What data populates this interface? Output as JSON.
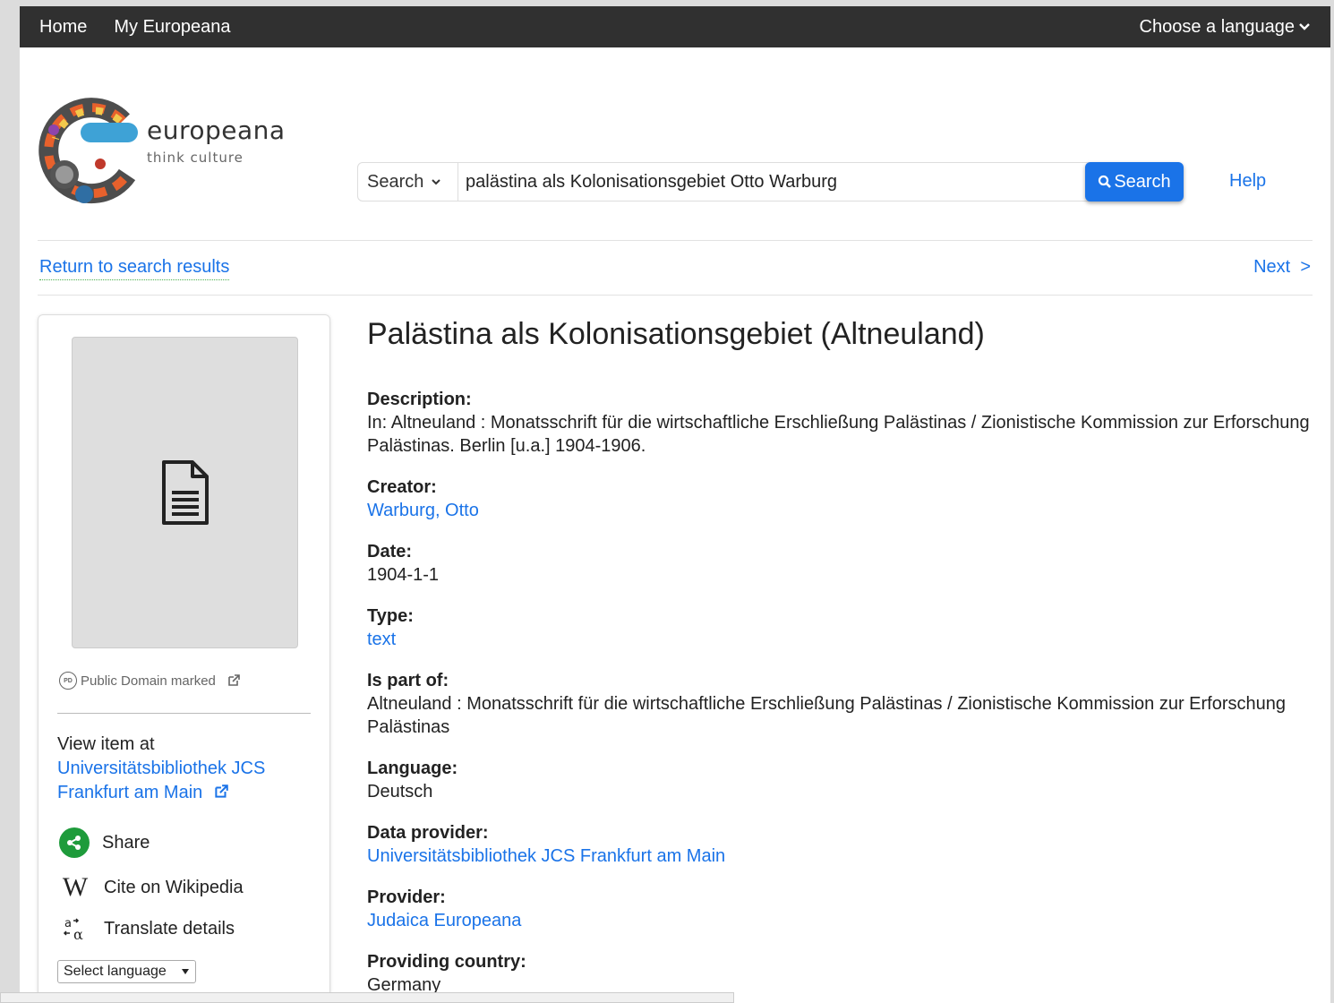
{
  "topbar": {
    "nav": [
      "Home",
      "My Europeana"
    ],
    "language_label": "Choose a language"
  },
  "logo": {
    "word": "europeana",
    "tagline": "think culture"
  },
  "search": {
    "type_label": "Search",
    "query": "palästina als Kolonisationsgebiet Otto Warburg",
    "button_label": "Search"
  },
  "help_label": "Help",
  "navigation": {
    "return_label": "Return to search results",
    "next_label": "Next  >"
  },
  "sidebar": {
    "rights_label": "Public Domain marked",
    "rights_badge": "PD",
    "view_item_at": "View item at",
    "provider_name": "Universitätsbibliothek JCS Frankfurt am Main",
    "actions": {
      "share": "Share",
      "cite": "Cite on Wikipedia",
      "translate": "Translate details"
    },
    "select_language": "Select language"
  },
  "item": {
    "title": "Palästina als Kolonisationsgebiet (Altneuland)",
    "fields": [
      {
        "label": "Description:",
        "value": "In: Altneuland : Monatsschrift für die wirtschaftliche Erschließung Palästinas / Zionistische Kommission zur Erforschung Palästinas. Berlin [u.a.] 1904-1906.",
        "link": false
      },
      {
        "label": "Creator:",
        "value": "Warburg, Otto",
        "link": true
      },
      {
        "label": "Date:",
        "value": "1904-1-1",
        "link": false
      },
      {
        "label": "Type:",
        "value": "text",
        "link": true
      },
      {
        "label": "Is part of:",
        "value": "Altneuland : Monatsschrift für die wirtschaftliche Erschließung Palästinas / Zionistische Kommission zur Erforschung Palästinas",
        "link": false
      },
      {
        "label": "Language:",
        "value": "Deutsch",
        "link": false
      },
      {
        "label": "Data provider:",
        "value": "Universitätsbibliothek JCS Frankfurt am Main",
        "link": true
      },
      {
        "label": "Provider:",
        "value": "Judaica Europeana",
        "link": true
      },
      {
        "label": "Providing country:",
        "value": "Germany",
        "link": false
      }
    ]
  },
  "colors": {
    "topbar": "#303030",
    "link": "#1a73e8",
    "search_button": "#1a73e8",
    "share_icon": "#1e9b3b"
  },
  "icons": [
    "chevron-down-icon",
    "search-icon",
    "document-icon",
    "public-domain-icon",
    "external-link-icon",
    "share-icon",
    "wikipedia-icon",
    "translate-icon"
  ]
}
